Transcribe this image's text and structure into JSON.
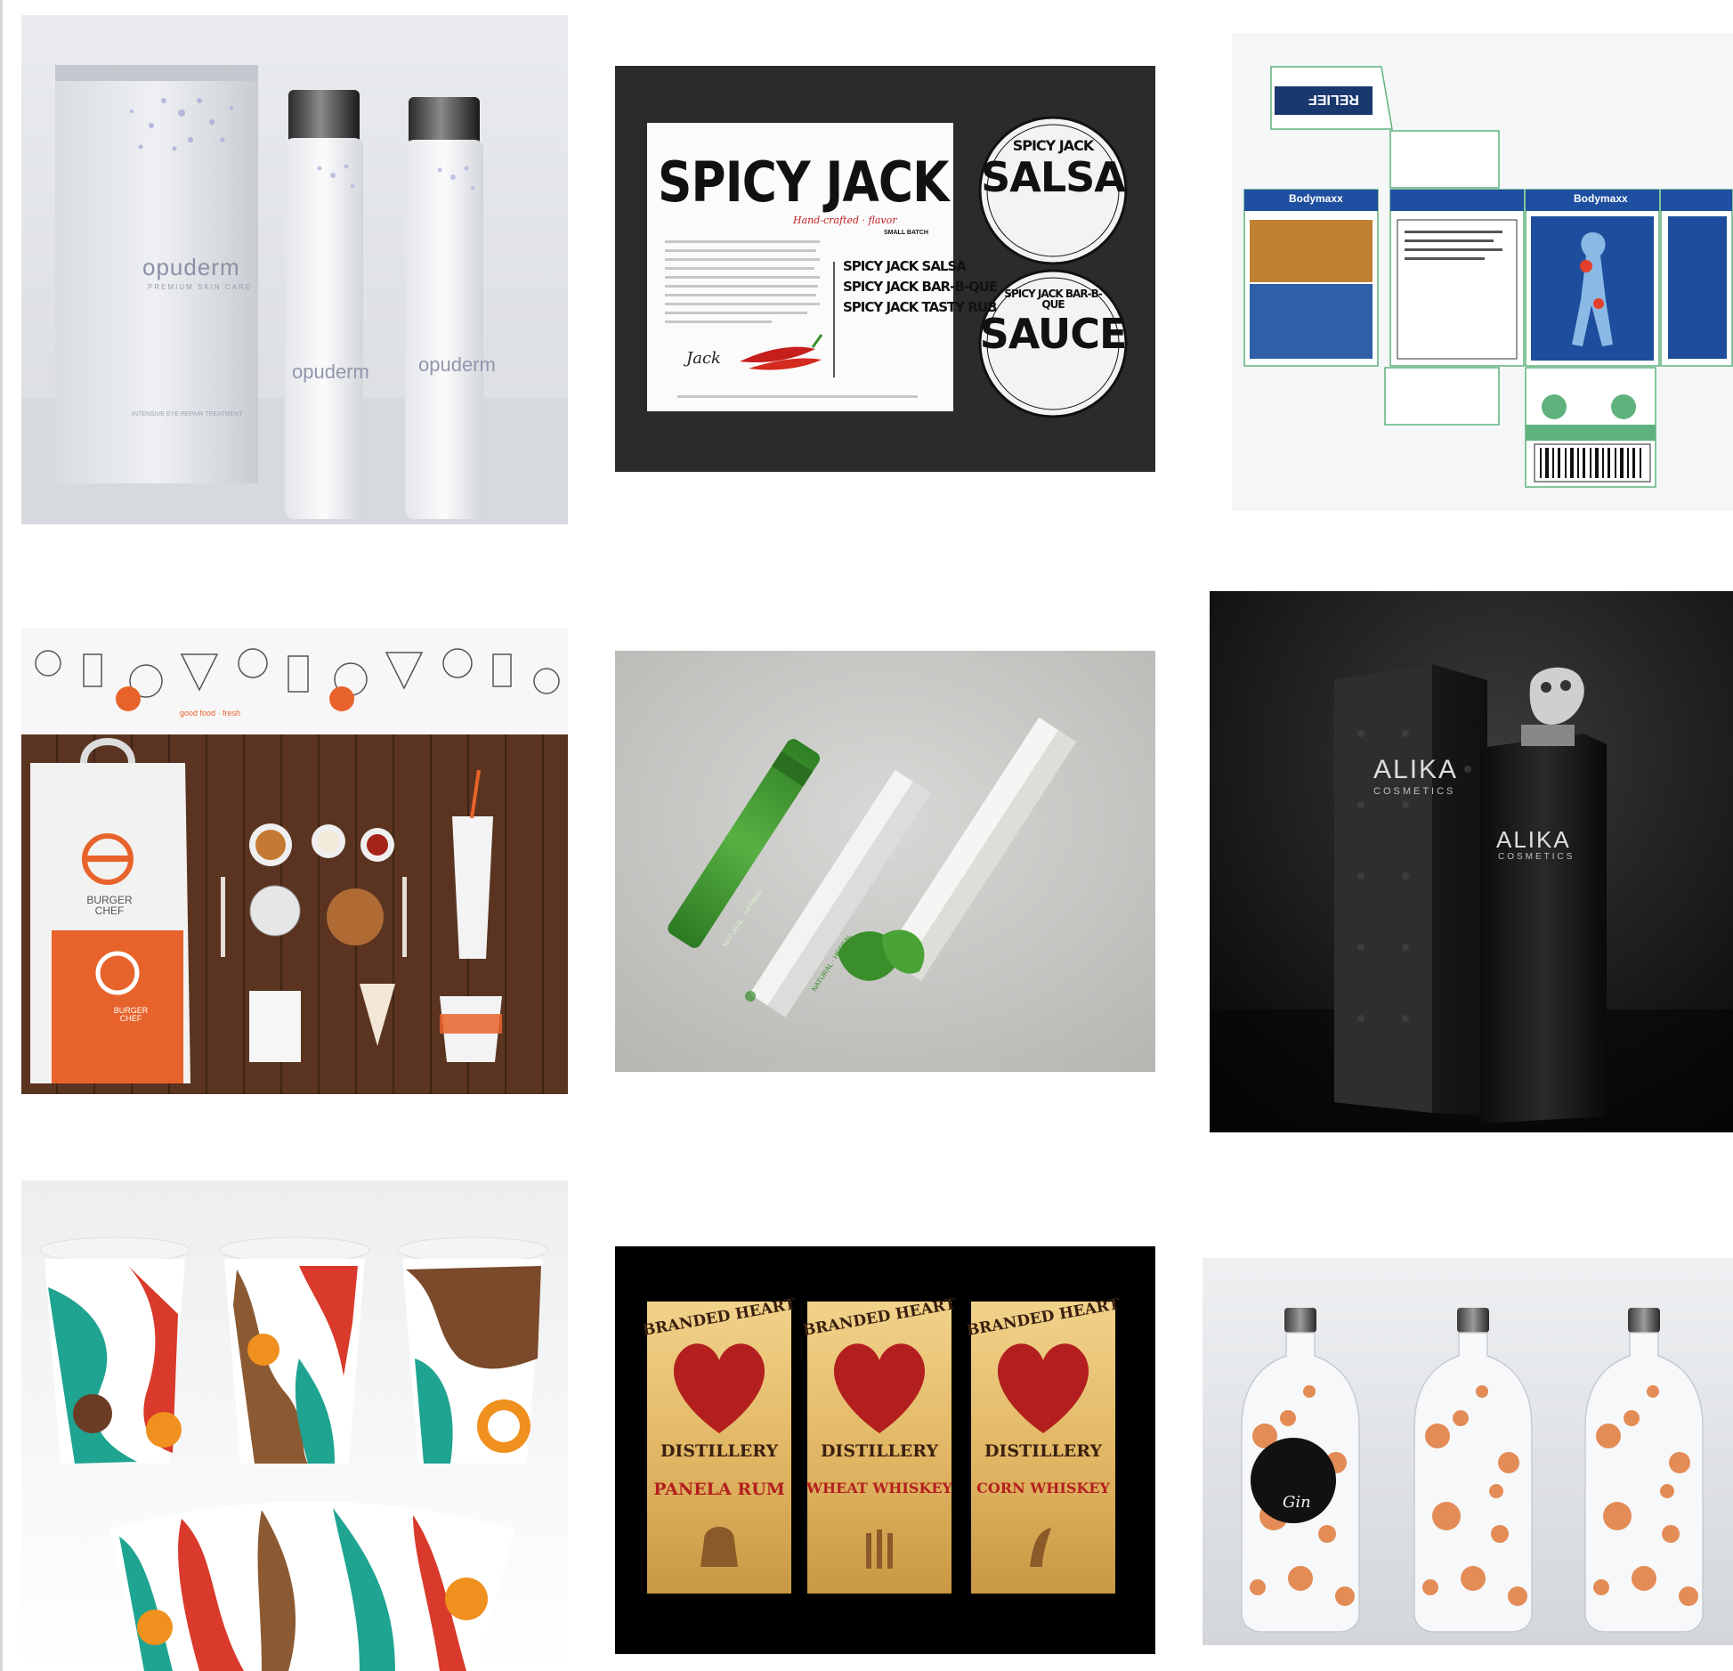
{
  "gallery": {
    "tiles": [
      {
        "id": "opuderm",
        "brand": "opuderm",
        "subline": "PREMIUM SKIN CARE",
        "product": "INTENSIVE EYE REPAIR TREATMENT"
      },
      {
        "id": "spicy-jack",
        "title": "SPICY JACK",
        "tagline": "Hand-crafted · flavor",
        "badge": "SMALL BATCH",
        "side_items": [
          "SPICY JACK SALSA",
          "SPICY JACK BAR-B-QUE",
          "SPICY JACK TASTY RUB"
        ],
        "signature": "Jack",
        "lid1_top": "SPICY JACK",
        "lid1_main": "SALSA",
        "lid2_top": "SPICY JACK BAR-B-QUE",
        "lid2_main": "SAUCE"
      },
      {
        "id": "bodymaxx",
        "brand": "Bodymaxx",
        "headline": "RELIEF"
      },
      {
        "id": "burger-chef",
        "brand": "BURGER CHEF",
        "pattern_text": "good food · fresh"
      },
      {
        "id": "green-tubes",
        "text": "NATURAL · HERBAL"
      },
      {
        "id": "alika",
        "brand": "ALIKA",
        "subline": "COSMETICS"
      },
      {
        "id": "coffee-cups"
      },
      {
        "id": "branded-heart",
        "arc": "BRANDED HEART",
        "word": "DISTILLERY",
        "labels": [
          "PANELA RUM",
          "WHEAT WHISKEY",
          "CORN WHISKEY"
        ]
      },
      {
        "id": "gin-bottles",
        "seal": "Gin"
      }
    ]
  },
  "colors": {
    "orange": "#e8632b",
    "burger_wood": "#5a3420",
    "salsa_bg": "#2b2b2b",
    "alika_bg": "#0e0e0e",
    "distillery_red": "#b31f1f",
    "gin_orange": "#e07a3a",
    "leaf_green": "#3a8f2b"
  }
}
